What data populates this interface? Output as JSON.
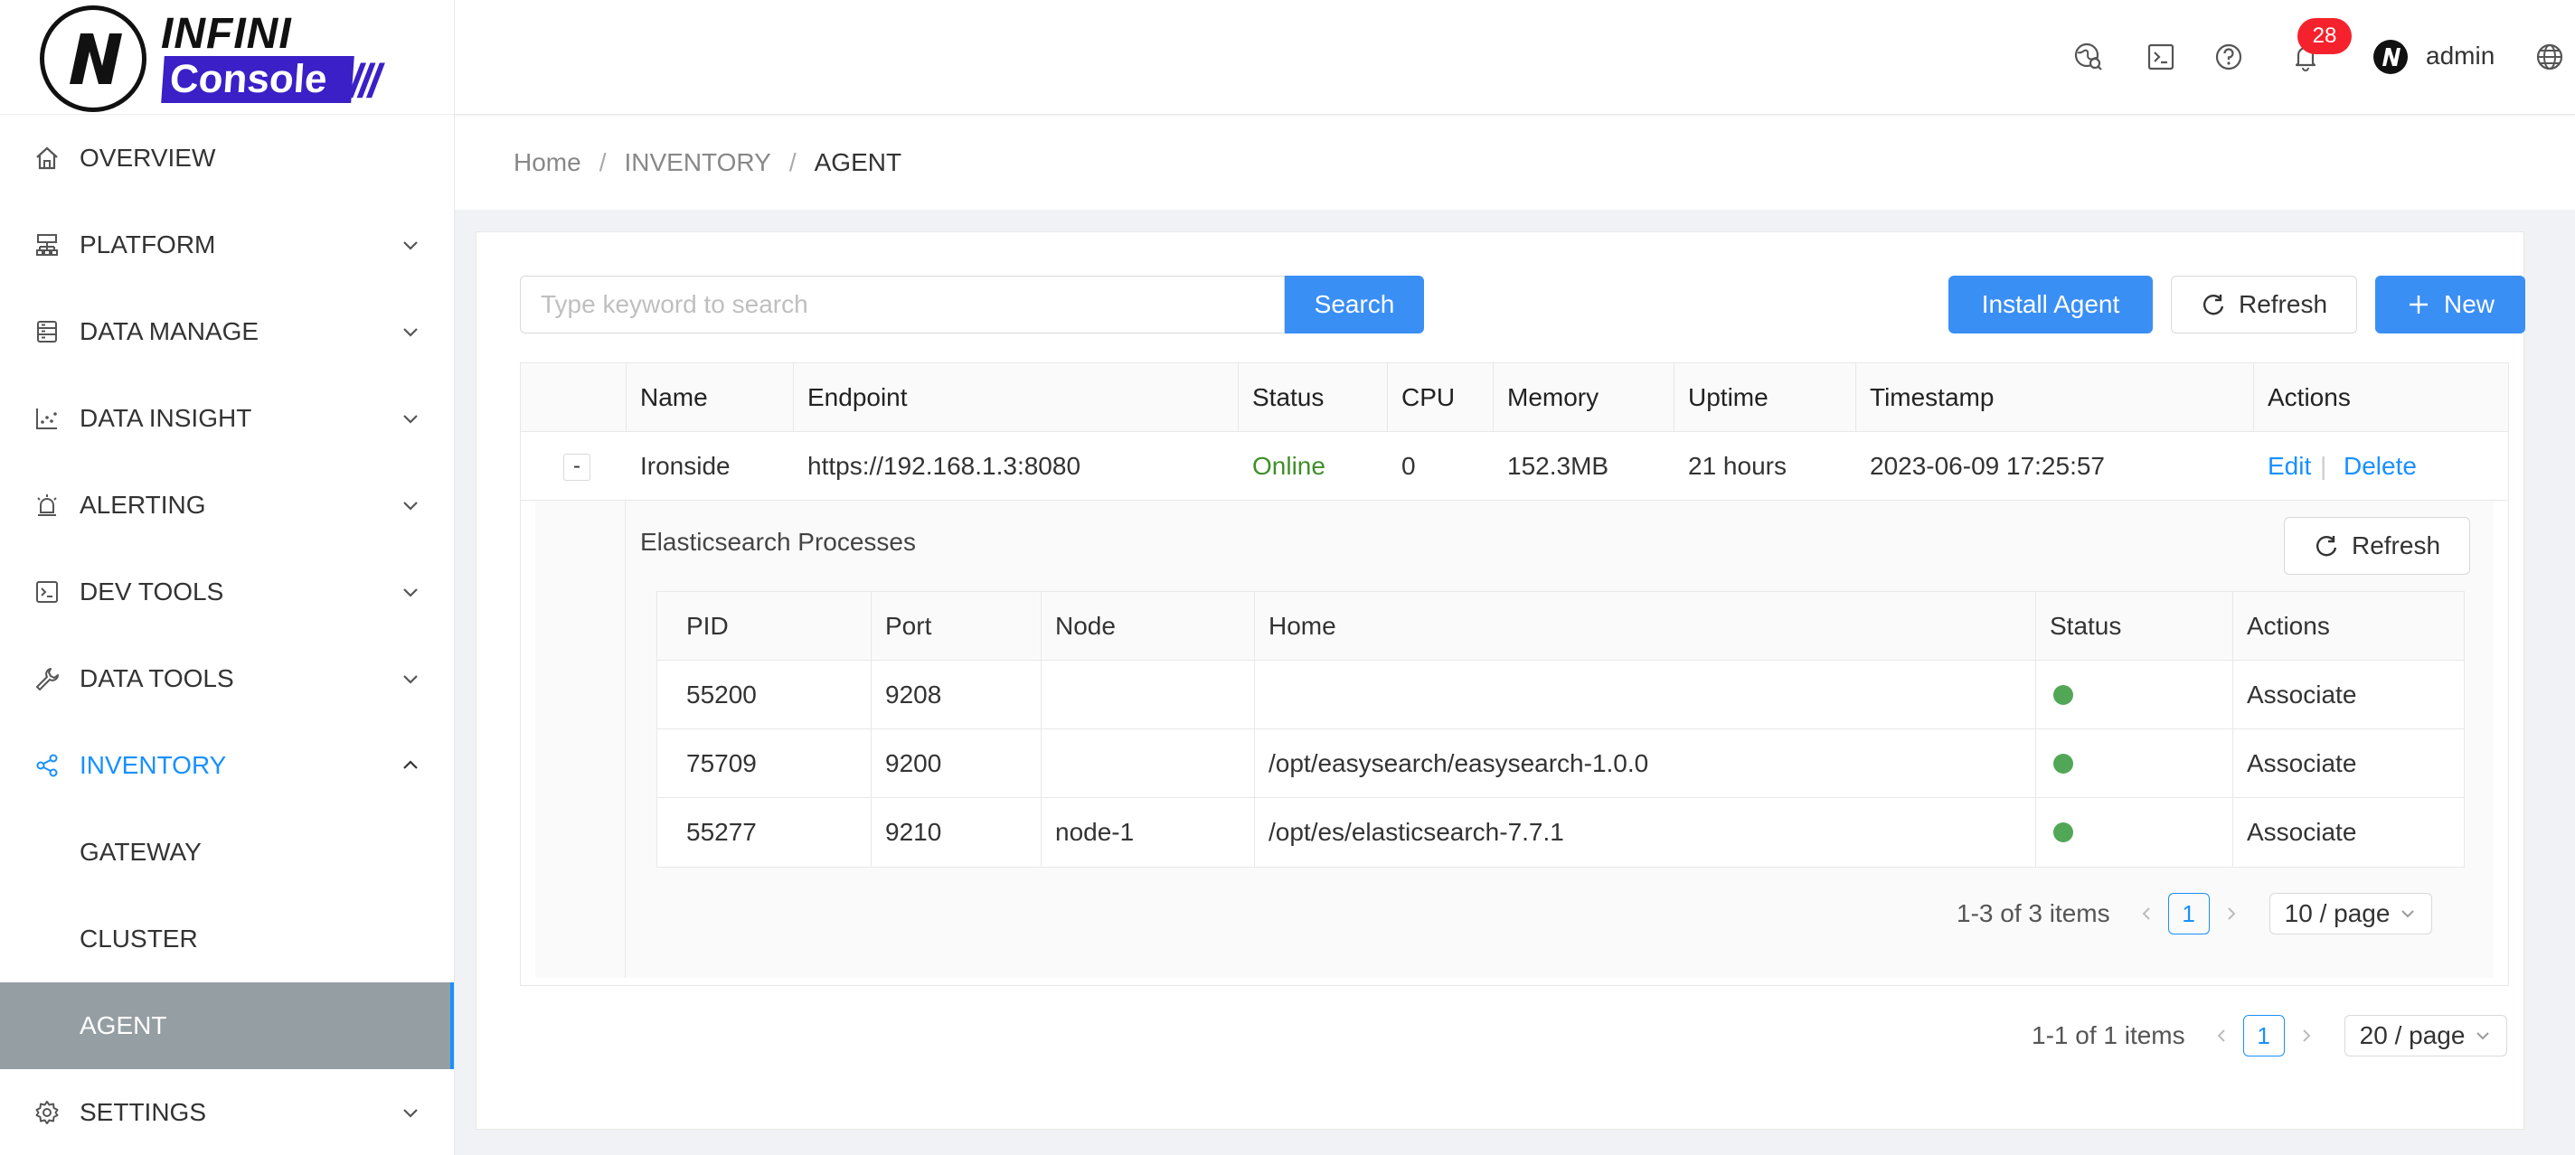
{
  "app": {
    "logo_top": "INFINI",
    "logo_bottom": "Console",
    "logo_slashes": "///"
  },
  "sidebar": {
    "items": [
      {
        "label": "OVERVIEW",
        "icon": "home-icon"
      },
      {
        "label": "PLATFORM",
        "icon": "platform-icon"
      },
      {
        "label": "DATA MANAGE",
        "icon": "database-icon"
      },
      {
        "label": "DATA INSIGHT",
        "icon": "chart-icon"
      },
      {
        "label": "ALERTING",
        "icon": "alarm-icon"
      },
      {
        "label": "DEV TOOLS",
        "icon": "terminal-icon"
      },
      {
        "label": "DATA TOOLS",
        "icon": "wrench-icon"
      },
      {
        "label": "INVENTORY",
        "icon": "share-icon"
      },
      {
        "label": "SETTINGS",
        "icon": "gear-icon"
      }
    ],
    "inventory_sub": [
      "GATEWAY",
      "CLUSTER",
      "AGENT"
    ]
  },
  "header": {
    "notification_count": "28",
    "username": "admin"
  },
  "breadcrumb": [
    "Home",
    "INVENTORY",
    "AGENT"
  ],
  "toolbar": {
    "search_placeholder": "Type keyword to search",
    "search_label": "Search",
    "install_label": "Install Agent",
    "refresh_label": "Refresh",
    "new_label": "New"
  },
  "table": {
    "columns": [
      "Name",
      "Endpoint",
      "Status",
      "CPU",
      "Memory",
      "Uptime",
      "Timestamp",
      "Actions"
    ],
    "row": {
      "expand": "-",
      "name": "Ironside",
      "endpoint": "https://192.168.1.3:8080",
      "status": "Online",
      "cpu": "0",
      "memory": "152.3MB",
      "uptime": "21 hours",
      "timestamp": "2023-06-09 17:25:57",
      "edit": "Edit",
      "divider": "|",
      "delete": "Delete"
    }
  },
  "processes": {
    "title": "Elasticsearch Processes",
    "refresh_label": "Refresh",
    "columns": [
      "PID",
      "Port",
      "Node",
      "Home",
      "Status",
      "Actions"
    ],
    "rows": [
      {
        "pid": "55200",
        "port": "9208",
        "node": "",
        "home": "",
        "action": "Associate"
      },
      {
        "pid": "75709",
        "port": "9200",
        "node": "",
        "home": "/opt/easysearch/easysearch-1.0.0",
        "action": "Associate"
      },
      {
        "pid": "55277",
        "port": "9210",
        "node": "node-1",
        "home": "/opt/es/elasticsearch-7.7.1",
        "action": "Associate"
      }
    ],
    "status_color": "#52a757",
    "pager": {
      "summary": "1-3 of 3 items",
      "page": "1",
      "size": "10 / page"
    }
  },
  "pager": {
    "summary": "1-1 of 1 items",
    "page": "1",
    "size": "20 / page"
  },
  "colors": {
    "primary": "#3a8ff5",
    "link": "#1890ff",
    "online": "#3f8f28",
    "badge": "#f5222d",
    "selected_bg": "#959ea2"
  }
}
